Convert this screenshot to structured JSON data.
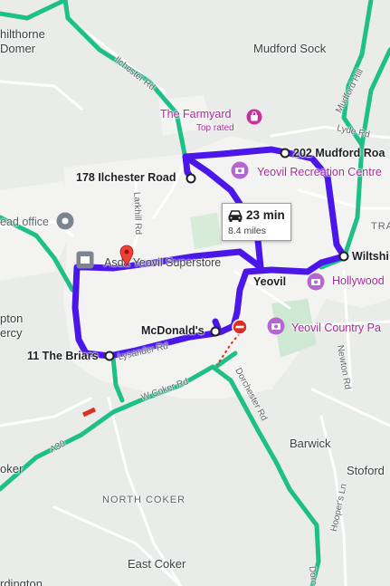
{
  "map": {
    "towns": [
      {
        "id": "chilthorne",
        "text": "hilthorne"
      },
      {
        "id": "domer",
        "text": "Domer"
      },
      {
        "id": "mudford_sock",
        "text": "Mudford Sock"
      },
      {
        "id": "yeovil",
        "text": "Yeovil"
      },
      {
        "id": "barwick",
        "text": "Barwick"
      },
      {
        "id": "stoford",
        "text": "Stoford"
      },
      {
        "id": "east_coker",
        "text": "East Coker"
      },
      {
        "id": "pton",
        "text": "pton"
      },
      {
        "id": "ercy",
        "text": "ercy"
      },
      {
        "id": "oker",
        "text": "oker"
      },
      {
        "id": "rdington",
        "text": "rdington"
      },
      {
        "id": "tra",
        "text": "TRA"
      }
    ],
    "districts": [
      {
        "text": "NORTH COKER"
      }
    ],
    "roads": [
      {
        "text": "Ilchester Rd"
      },
      {
        "text": "Larkhill Rd"
      },
      {
        "text": "Lysander Rd"
      },
      {
        "text": "W Coker Rd"
      },
      {
        "text": "Dorchester Rd"
      },
      {
        "text": "A30"
      },
      {
        "text": "Lyde Rd"
      },
      {
        "text": "Mudford Hill"
      },
      {
        "text": "Newton Rd"
      },
      {
        "text": "Hooper's Ln"
      },
      {
        "text": "Dorc"
      }
    ],
    "stops": [
      {
        "text": "178 Ilchester Road"
      },
      {
        "text": "202 Mudford Roa"
      },
      {
        "text": "Wiltshi"
      },
      {
        "text": "McDonald's"
      },
      {
        "text": "11 The Briars"
      }
    ],
    "pois": [
      {
        "text": "The Farmyard",
        "sub": "Top rated",
        "icon": "shopping-bag-icon"
      },
      {
        "text": "Yeovil Recreation Centre",
        "icon": "camera-icon"
      },
      {
        "text": "Hollywood",
        "icon": "camera-icon"
      },
      {
        "text": "Yeovil Country Pa",
        "icon": "camera-icon"
      },
      {
        "text": "Asda Yeovil Superstore",
        "icon": "red-pin-icon"
      },
      {
        "text": "ead office",
        "icon": "gray-pin-icon"
      }
    ],
    "route_summary": {
      "time": "23 min",
      "distance": "8.4 miles",
      "icon": "car-icon"
    },
    "colors": {
      "route": "#4b17e8",
      "major_road": "#1fbf88",
      "poi": "#b0269e",
      "pin": "#ea4335"
    }
  }
}
